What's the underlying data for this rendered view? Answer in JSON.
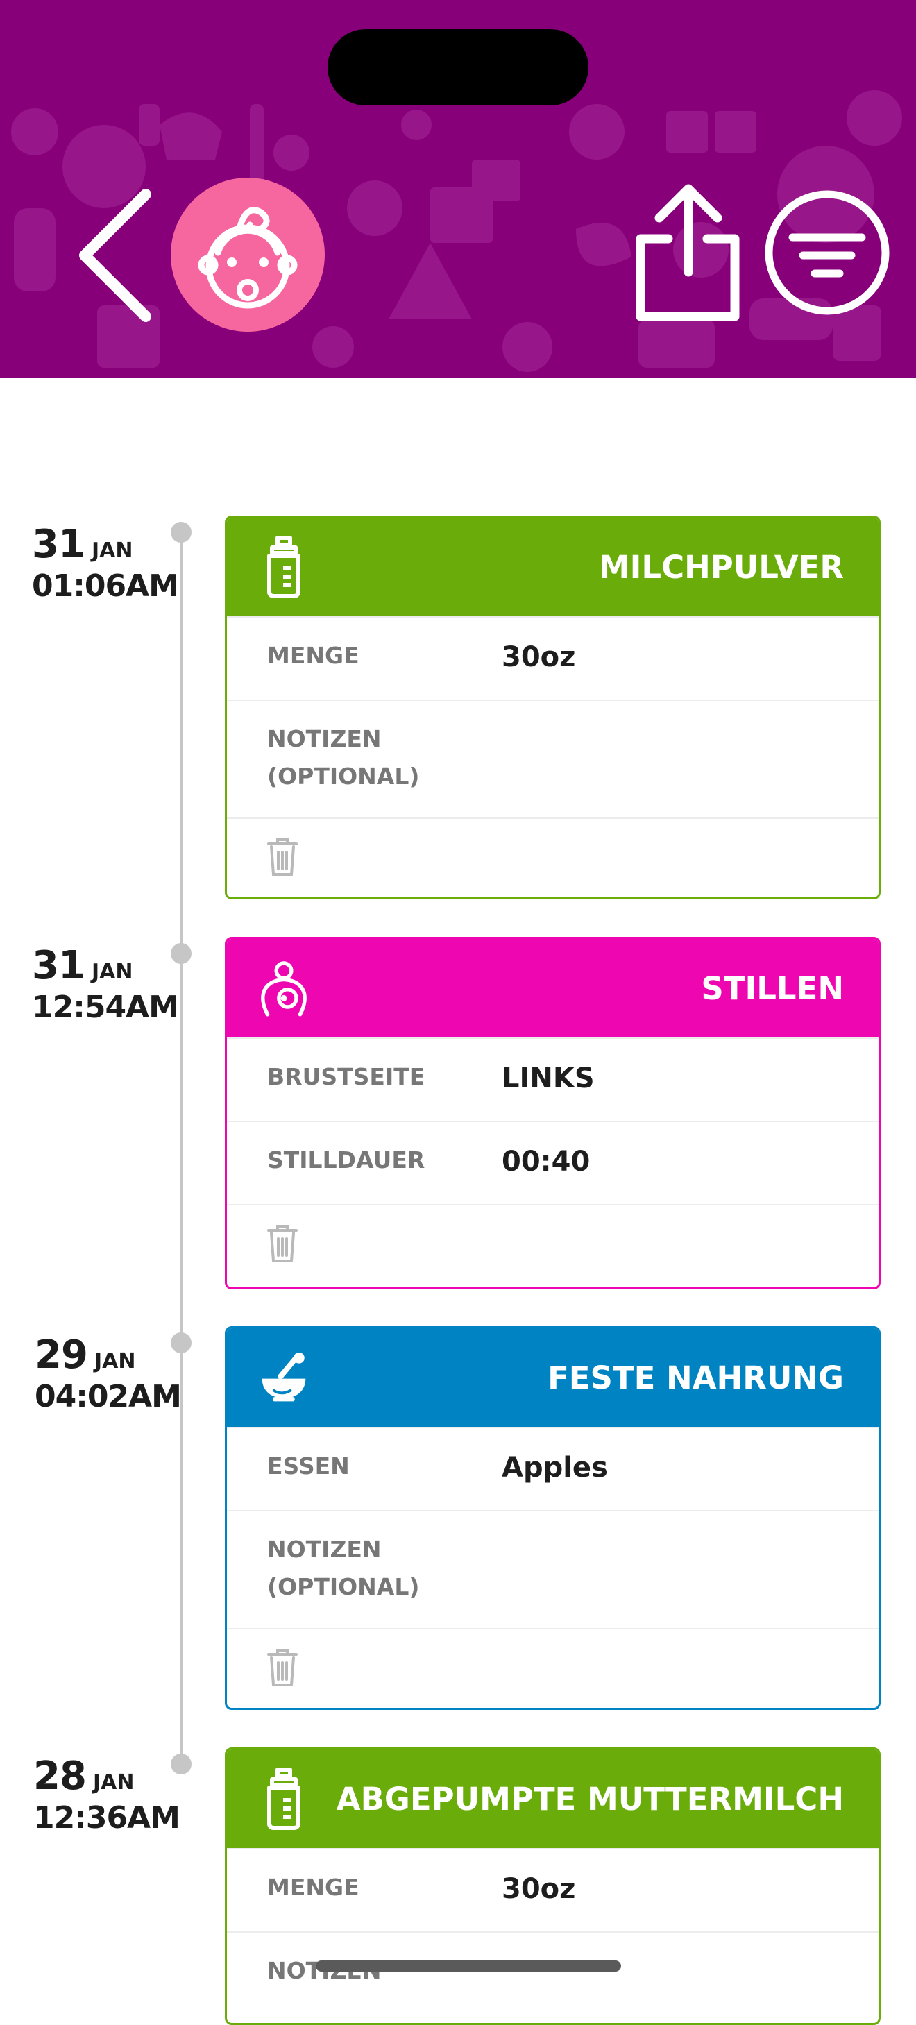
{
  "header": {
    "background_color": "#870079",
    "back_icon": "chevron-left-icon",
    "avatar_icon": "baby-face-icon",
    "share_icon": "share-icon",
    "filter_icon": "filter-icon"
  },
  "entries": [
    {
      "day": "31",
      "month": "JAN",
      "time": "01:06AM",
      "title": "MILCHPULVER",
      "color": "#6aad0a",
      "icon": "baby-bottle-icon",
      "rows": [
        {
          "label": "MENGE",
          "value": "30oz"
        },
        {
          "label": "NOTIZEN (OPTIONAL)",
          "value": ""
        }
      ]
    },
    {
      "day": "31",
      "month": "JAN",
      "time": "12:54AM",
      "title": "STILLEN",
      "color": "#ee06b1",
      "icon": "breastfeeding-icon",
      "rows": [
        {
          "label": "BRUSTSEITE",
          "value": "LINKS"
        },
        {
          "label": "STILLDAUER",
          "value": "00:40"
        }
      ]
    },
    {
      "day": "29",
      "month": "JAN",
      "time": "04:02AM",
      "title": "FESTE NAHRUNG",
      "color": "#0083c2",
      "icon": "mortar-pestle-icon",
      "rows": [
        {
          "label": "ESSEN",
          "value": "Apples"
        },
        {
          "label": "NOTIZEN (OPTIONAL)",
          "value": ""
        }
      ]
    },
    {
      "day": "28",
      "month": "JAN",
      "time": "12:36AM",
      "title": "ABGEPUMPTE MUTTERMILCH",
      "color": "#6aad0a",
      "icon": "baby-bottle-icon",
      "rows": [
        {
          "label": "MENGE",
          "value": "30oz"
        },
        {
          "label": "NOTIZEN",
          "value": ""
        }
      ]
    }
  ],
  "trash_icon": "trash-icon"
}
